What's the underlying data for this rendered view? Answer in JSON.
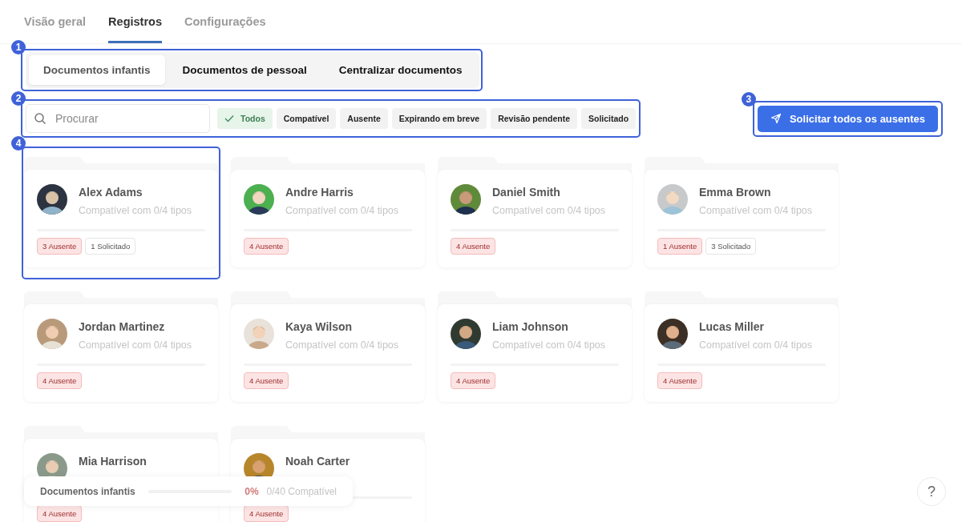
{
  "top_tabs": [
    {
      "label": "Visão geral",
      "selected": false
    },
    {
      "label": "Registros",
      "selected": true
    },
    {
      "label": "Configurações",
      "selected": false
    }
  ],
  "segments": {
    "callout": "1",
    "items": [
      {
        "label": "Documentos infantis",
        "selected": true
      },
      {
        "label": "Documentos de pessoal",
        "selected": false
      },
      {
        "label": "Centralizar documentos",
        "selected": false
      }
    ]
  },
  "filters": {
    "callout": "2",
    "search": {
      "placeholder": "Procurar"
    },
    "chips": [
      {
        "label": "Todos",
        "selected": true
      },
      {
        "label": "Compatível",
        "selected": false
      },
      {
        "label": "Ausente",
        "selected": false
      },
      {
        "label": "Expirando em breve",
        "selected": false
      },
      {
        "label": "Revisão pendente",
        "selected": false
      },
      {
        "label": "Solicitado",
        "selected": false
      }
    ]
  },
  "request_button": {
    "callout": "3",
    "label": "Solicitar todos os ausentes"
  },
  "cards": [
    {
      "name": "Alex Adams",
      "subtitle": "Compatível com 0/4 tipos",
      "callout": "4",
      "badges": [
        {
          "kind": "absent",
          "label": "3 Ausente"
        },
        {
          "kind": "requested",
          "label": "1 Solicitado"
        }
      ]
    },
    {
      "name": "Andre Harris",
      "subtitle": "Compatível com 0/4 tipos",
      "badges": [
        {
          "kind": "absent",
          "label": "4 Ausente"
        }
      ]
    },
    {
      "name": "Daniel Smith",
      "subtitle": "Compatível com 0/4 tipos",
      "badges": [
        {
          "kind": "absent",
          "label": "4 Ausente"
        }
      ]
    },
    {
      "name": "Emma Brown",
      "subtitle": "Compatível com 0/4 tipos",
      "badges": [
        {
          "kind": "absent",
          "label": "1 Ausente"
        },
        {
          "kind": "requested",
          "label": "3 Solicitado"
        }
      ]
    },
    {
      "name": "Jordan Martinez",
      "subtitle": "Compatível com 0/4 tipos",
      "badges": [
        {
          "kind": "absent",
          "label": "4 Ausente"
        }
      ]
    },
    {
      "name": "Kaya Wilson",
      "subtitle": "Compatível com 0/4 tipos",
      "badges": [
        {
          "kind": "absent",
          "label": "4 Ausente"
        }
      ]
    },
    {
      "name": "Liam Johnson",
      "subtitle": "Compatível com 0/4 tipos",
      "badges": [
        {
          "kind": "absent",
          "label": "4 Ausente"
        }
      ]
    },
    {
      "name": "Lucas Miller",
      "subtitle": "Compatível com 0/4 tipos",
      "badges": [
        {
          "kind": "absent",
          "label": "4 Ausente"
        }
      ]
    },
    {
      "name": "Mia Harrison",
      "badges": [
        {
          "kind": "absent",
          "label": "4 Ausente"
        }
      ]
    },
    {
      "name": "Noah Carter",
      "badges": [
        {
          "kind": "absent",
          "label": "4 Ausente"
        }
      ]
    }
  ],
  "progress_bar": {
    "title": "Documentos infantis",
    "percent": "0%",
    "summary": "0/40 Compatível"
  },
  "help_button": {
    "label": "?"
  }
}
